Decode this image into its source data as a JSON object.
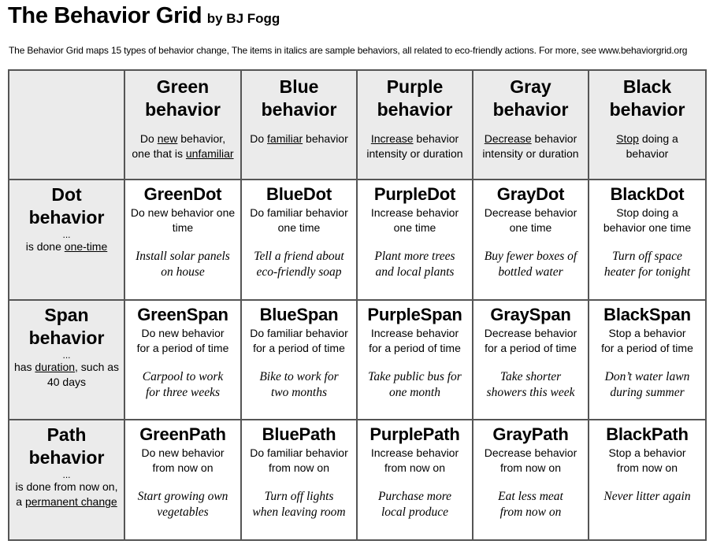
{
  "header": {
    "title": "The Behavior Grid",
    "byline": "by BJ Fogg",
    "subtitle": "The Behavior Grid maps 15 types of behavior change, The items in italics are sample behaviors, all related to eco-friendly actions. For more, see www.behaviorgrid.org"
  },
  "columns": [
    {
      "title_line1": "Green",
      "title_line2": "behavior",
      "desc_pre": "Do ",
      "desc_u": "new",
      "desc_post": " behavior,",
      "desc_line2_pre": "one that is ",
      "desc_line2_u": "unfamiliar"
    },
    {
      "title_line1": "Blue",
      "title_line2": "behavior",
      "desc_pre": "Do ",
      "desc_u": "familiar",
      "desc_post": " behavior",
      "desc_line2_pre": "",
      "desc_line2_u": ""
    },
    {
      "title_line1": "Purple",
      "title_line2": "behavior",
      "desc_pre": "",
      "desc_u": "Increase",
      "desc_post": " behavior",
      "desc_line2_pre": "intensity or duration",
      "desc_line2_u": ""
    },
    {
      "title_line1": "Gray",
      "title_line2": "behavior",
      "desc_pre": "",
      "desc_u": "Decrease",
      "desc_post": " behavior",
      "desc_line2_pre": "intensity or duration",
      "desc_line2_u": ""
    },
    {
      "title_line1": "Black",
      "title_line2": "behavior",
      "desc_pre": "",
      "desc_u": "Stop",
      "desc_post": " doing a",
      "desc_line2_pre": "behavior",
      "desc_line2_u": ""
    }
  ],
  "rows": [
    {
      "title_line1": "Dot",
      "title_line2": "behavior",
      "dots": "...",
      "desc_pre": "is done ",
      "desc_u": "one-time",
      "desc_post": "",
      "desc_line2_pre": "",
      "desc_line2_u": "",
      "cells": [
        {
          "title": "GreenDot",
          "desc1": "Do new behavior one",
          "desc2": "time",
          "ex1": "Install solar panels",
          "ex2": "on house"
        },
        {
          "title": "BlueDot",
          "desc1": "Do familiar behavior",
          "desc2": "one time",
          "ex1": "Tell a friend about",
          "ex2": "eco-friendly soap"
        },
        {
          "title": "PurpleDot",
          "desc1": "Increase behavior",
          "desc2": "one time",
          "ex1": "Plant more trees",
          "ex2": "and local plants"
        },
        {
          "title": "GrayDot",
          "desc1": "Decrease behavior",
          "desc2": "one time",
          "ex1": "Buy fewer boxes of",
          "ex2": "bottled water"
        },
        {
          "title": "BlackDot",
          "desc1": "Stop doing a",
          "desc2": "behavior one time",
          "ex1": "Turn off space",
          "ex2": "heater for tonight"
        }
      ]
    },
    {
      "title_line1": "Span",
      "title_line2": "behavior",
      "dots": "...",
      "desc_pre": "has ",
      "desc_u": "duration",
      "desc_post": ", such as",
      "desc_line2_pre": "40 days",
      "desc_line2_u": "",
      "cells": [
        {
          "title": "GreenSpan",
          "desc1": "Do new behavior",
          "desc2": "for a period of time",
          "ex1": "Carpool to work",
          "ex2": "for three weeks"
        },
        {
          "title": "BlueSpan",
          "desc1": "Do familiar behavior",
          "desc2": "for a period of time",
          "ex1": "Bike to work for",
          "ex2": "two months"
        },
        {
          "title": "PurpleSpan",
          "desc1": "Increase behavior",
          "desc2": "for a period of time",
          "ex1": "Take public bus for",
          "ex2": "one month"
        },
        {
          "title": "GraySpan",
          "desc1": "Decrease behavior",
          "desc2": "for a period of time",
          "ex1": "Take shorter",
          "ex2": "showers this week"
        },
        {
          "title": "BlackSpan",
          "desc1": "Stop a behavior",
          "desc2": "for a period of time",
          "ex1": "Don’t water lawn",
          "ex2": "during summer"
        }
      ]
    },
    {
      "title_line1": "Path",
      "title_line2": "behavior",
      "dots": "...",
      "desc_pre": "is done from now on,",
      "desc_u": "",
      "desc_post": "",
      "desc_line2_pre": "a ",
      "desc_line2_u": "permanent change",
      "cells": [
        {
          "title": "GreenPath",
          "desc1": "Do new behavior",
          "desc2": "from now on",
          "ex1": "Start growing own",
          "ex2": "vegetables"
        },
        {
          "title": "BluePath",
          "desc1": "Do familiar behavior",
          "desc2": "from now on",
          "ex1": "Turn off lights",
          "ex2": "when leaving room"
        },
        {
          "title": "PurplePath",
          "desc1": "Increase behavior",
          "desc2": "from now on",
          "ex1": "Purchase more",
          "ex2": "local produce"
        },
        {
          "title": "GrayPath",
          "desc1": "Decrease behavior",
          "desc2": "from now on",
          "ex1": "Eat less meat",
          "ex2": "from now on"
        },
        {
          "title": "BlackPath",
          "desc1": "Stop a behavior",
          "desc2": "from now on",
          "ex1": "Never litter again",
          "ex2": ""
        }
      ]
    }
  ]
}
